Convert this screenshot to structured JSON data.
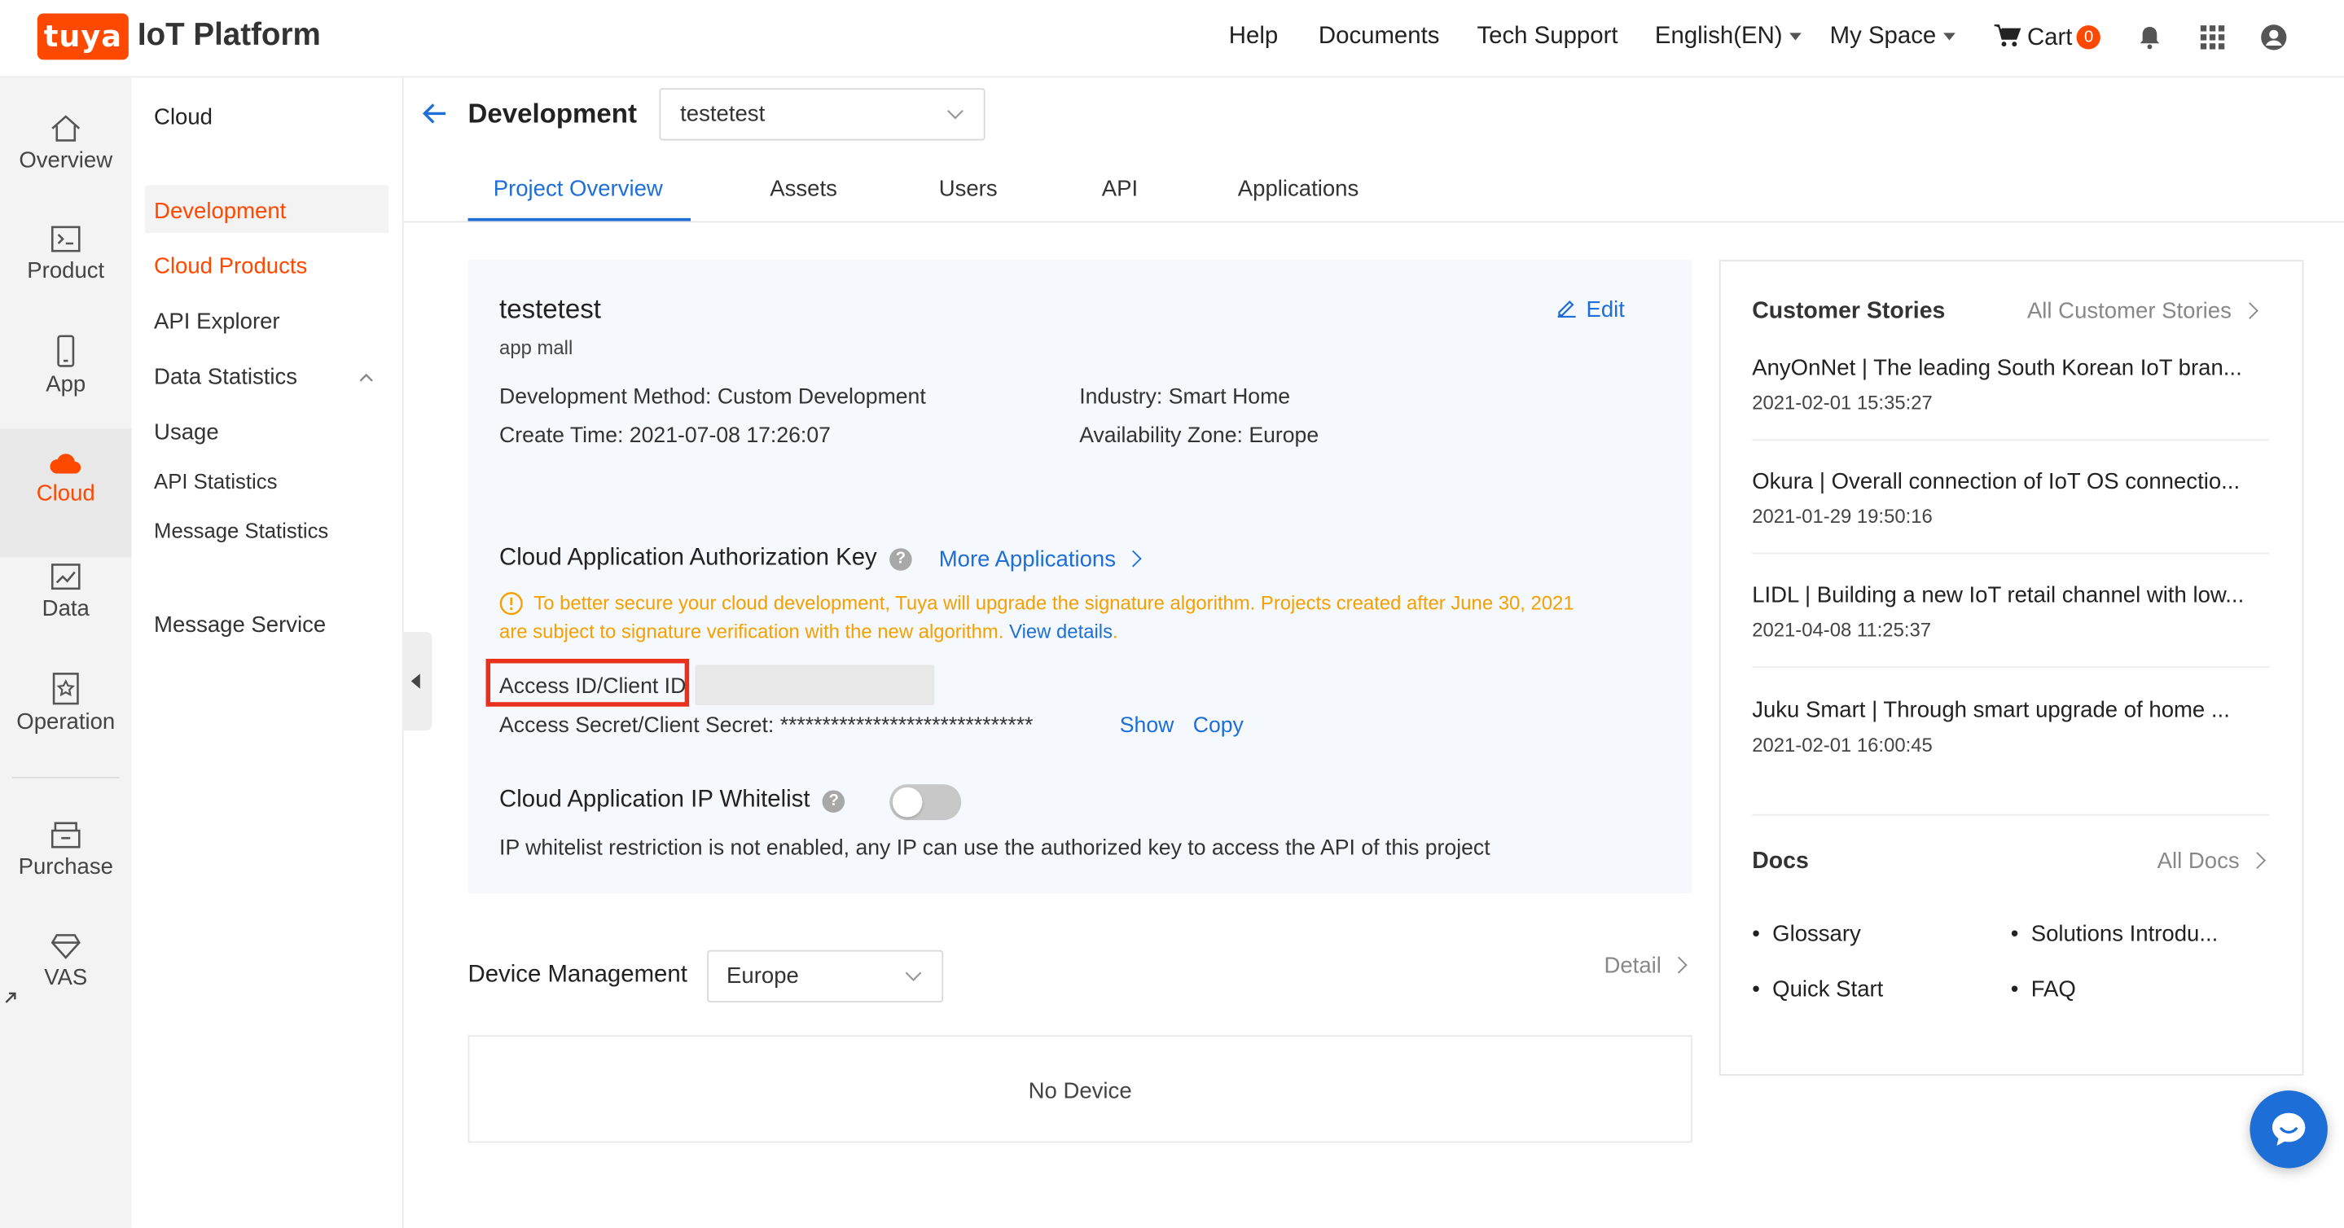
{
  "brand": {
    "logo_text": "tuya",
    "product_name": "IoT Platform",
    "accent_color": "#ff4800"
  },
  "topnav": {
    "help": "Help",
    "documents": "Documents",
    "tech_support": "Tech Support",
    "language": "English(EN)",
    "my_space": "My Space",
    "cart": "Cart",
    "cart_count": "0"
  },
  "rail": {
    "overview": "Overview",
    "product": "Product",
    "app": "App",
    "cloud": "Cloud",
    "data": "Data",
    "operation": "Operation",
    "purchase": "Purchase",
    "vas": "VAS"
  },
  "sidebar": {
    "section_title": "Cloud",
    "development": "Development",
    "cloud_products": "Cloud Products",
    "api_explorer": "API Explorer",
    "data_statistics": "Data Statistics",
    "usage": "Usage",
    "api_statistics": "API Statistics",
    "message_statistics": "Message Statistics",
    "message_service": "Message Service"
  },
  "header": {
    "title": "Development",
    "project_select_value": "testetest",
    "tabs": [
      "Project Overview",
      "Assets",
      "Users",
      "API",
      "Applications"
    ]
  },
  "project": {
    "name": "testetest",
    "subtitle": "app mall",
    "edit_label": "Edit",
    "development_method": "Development Method: Custom Development",
    "industry": "Industry: Smart Home",
    "create_time": "Create Time: 2021-07-08 17:26:07",
    "availability_zone": "Availability Zone: Europe"
  },
  "auth": {
    "title": "Cloud Application Authorization Key",
    "more_applications": "More Applications",
    "warning_line1": "To better secure your cloud development, Tuya will upgrade the signature algorithm. Projects created after June 30, 2021",
    "warning_line2": "are subject to signature verification with the new algorithm.",
    "view_details": "View details",
    "warning_end": ".",
    "access_id_label": "Access ID/Client ID",
    "access_secret_label": "Access Secret/Client Secret: ******************************",
    "show": "Show",
    "copy": "Copy"
  },
  "whitelist": {
    "title": "Cloud Application IP Whitelist",
    "enabled": false,
    "note": "IP whitelist restriction is not enabled, any IP can use the authorized key to access the API of this project"
  },
  "device_mgmt": {
    "title": "Device Management",
    "region": "Europe",
    "detail": "Detail",
    "empty": "No Device"
  },
  "customer_stories": {
    "title": "Customer Stories",
    "all_link": "All Customer Stories",
    "items": [
      {
        "title": "AnyOnNet | The leading South Korean IoT bran...",
        "date": "2021-02-01 15:35:27"
      },
      {
        "title": "Okura | Overall connection of IoT OS connectio...",
        "date": "2021-01-29 19:50:16"
      },
      {
        "title": "LIDL | Building a new IoT retail channel with low...",
        "date": "2021-04-08 11:25:37"
      },
      {
        "title": "Juku Smart | Through smart upgrade of home ...",
        "date": "2021-02-01 16:00:45"
      }
    ]
  },
  "docs": {
    "title": "Docs",
    "all_link": "All Docs",
    "items": [
      "Glossary",
      "Solutions Introdu...",
      "Quick Start",
      "FAQ"
    ]
  },
  "icons": {
    "back": "arrow-left-icon",
    "edit": "pencil-icon",
    "bell": "bell-icon",
    "apps": "grid-icon",
    "user": "user-icon",
    "chat": "chat-icon"
  }
}
